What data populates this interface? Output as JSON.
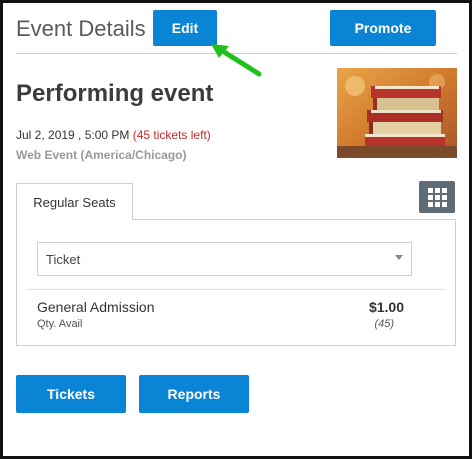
{
  "header": {
    "title": "Event Details",
    "edit_label": "Edit",
    "promote_label": "Promote"
  },
  "event": {
    "name": "Performing event",
    "date": "Jul 2, 2019 , 5:00 PM",
    "tickets_left": "(45 tickets left)",
    "timezone": "Web Event (America/Chicago)",
    "image_icon": "book-stack-photo"
  },
  "tabs": [
    {
      "label": "Regular Seats"
    }
  ],
  "grid_button": {
    "icon": "grid-icon"
  },
  "ticket_select": {
    "value": "Ticket"
  },
  "admission": {
    "name": "General Admission",
    "qty_label": "Qty. Avail",
    "price": "$1.00",
    "available": "(45)"
  },
  "footer": {
    "tickets_label": "Tickets",
    "reports_label": "Reports"
  },
  "colors": {
    "button_blue": "#0a85d6",
    "tickets_left_red": "#c62828",
    "arrow_green": "#22c01e",
    "grid_button_gray": "#5f6b75"
  }
}
